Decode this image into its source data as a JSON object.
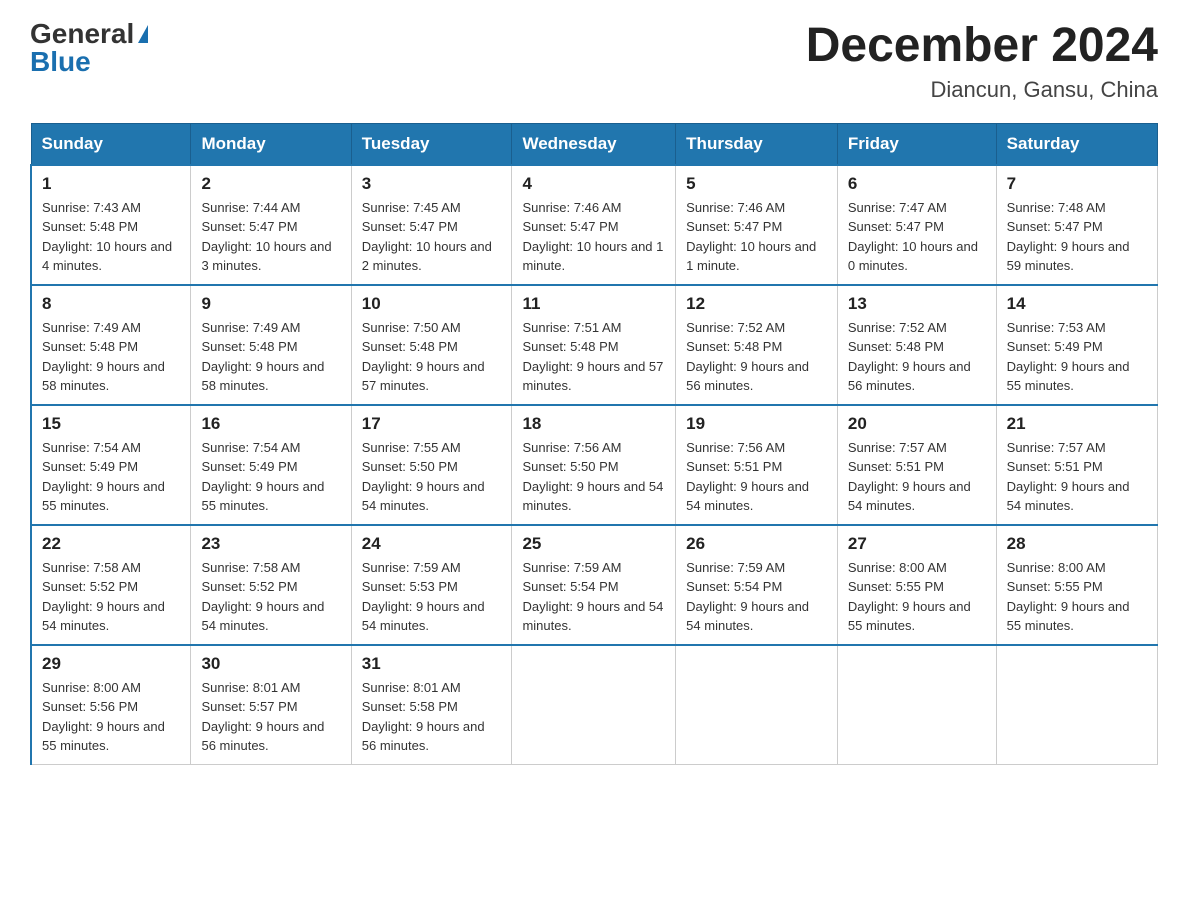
{
  "header": {
    "logo": {
      "general": "General",
      "blue": "Blue"
    },
    "title": "December 2024",
    "location": "Diancun, Gansu, China"
  },
  "days_of_week": [
    "Sunday",
    "Monday",
    "Tuesday",
    "Wednesday",
    "Thursday",
    "Friday",
    "Saturday"
  ],
  "weeks": [
    [
      {
        "day": "1",
        "sunrise": "7:43 AM",
        "sunset": "5:48 PM",
        "daylight": "10 hours and 4 minutes."
      },
      {
        "day": "2",
        "sunrise": "7:44 AM",
        "sunset": "5:47 PM",
        "daylight": "10 hours and 3 minutes."
      },
      {
        "day": "3",
        "sunrise": "7:45 AM",
        "sunset": "5:47 PM",
        "daylight": "10 hours and 2 minutes."
      },
      {
        "day": "4",
        "sunrise": "7:46 AM",
        "sunset": "5:47 PM",
        "daylight": "10 hours and 1 minute."
      },
      {
        "day": "5",
        "sunrise": "7:46 AM",
        "sunset": "5:47 PM",
        "daylight": "10 hours and 1 minute."
      },
      {
        "day": "6",
        "sunrise": "7:47 AM",
        "sunset": "5:47 PM",
        "daylight": "10 hours and 0 minutes."
      },
      {
        "day": "7",
        "sunrise": "7:48 AM",
        "sunset": "5:47 PM",
        "daylight": "9 hours and 59 minutes."
      }
    ],
    [
      {
        "day": "8",
        "sunrise": "7:49 AM",
        "sunset": "5:48 PM",
        "daylight": "9 hours and 58 minutes."
      },
      {
        "day": "9",
        "sunrise": "7:49 AM",
        "sunset": "5:48 PM",
        "daylight": "9 hours and 58 minutes."
      },
      {
        "day": "10",
        "sunrise": "7:50 AM",
        "sunset": "5:48 PM",
        "daylight": "9 hours and 57 minutes."
      },
      {
        "day": "11",
        "sunrise": "7:51 AM",
        "sunset": "5:48 PM",
        "daylight": "9 hours and 57 minutes."
      },
      {
        "day": "12",
        "sunrise": "7:52 AM",
        "sunset": "5:48 PM",
        "daylight": "9 hours and 56 minutes."
      },
      {
        "day": "13",
        "sunrise": "7:52 AM",
        "sunset": "5:48 PM",
        "daylight": "9 hours and 56 minutes."
      },
      {
        "day": "14",
        "sunrise": "7:53 AM",
        "sunset": "5:49 PM",
        "daylight": "9 hours and 55 minutes."
      }
    ],
    [
      {
        "day": "15",
        "sunrise": "7:54 AM",
        "sunset": "5:49 PM",
        "daylight": "9 hours and 55 minutes."
      },
      {
        "day": "16",
        "sunrise": "7:54 AM",
        "sunset": "5:49 PM",
        "daylight": "9 hours and 55 minutes."
      },
      {
        "day": "17",
        "sunrise": "7:55 AM",
        "sunset": "5:50 PM",
        "daylight": "9 hours and 54 minutes."
      },
      {
        "day": "18",
        "sunrise": "7:56 AM",
        "sunset": "5:50 PM",
        "daylight": "9 hours and 54 minutes."
      },
      {
        "day": "19",
        "sunrise": "7:56 AM",
        "sunset": "5:51 PM",
        "daylight": "9 hours and 54 minutes."
      },
      {
        "day": "20",
        "sunrise": "7:57 AM",
        "sunset": "5:51 PM",
        "daylight": "9 hours and 54 minutes."
      },
      {
        "day": "21",
        "sunrise": "7:57 AM",
        "sunset": "5:51 PM",
        "daylight": "9 hours and 54 minutes."
      }
    ],
    [
      {
        "day": "22",
        "sunrise": "7:58 AM",
        "sunset": "5:52 PM",
        "daylight": "9 hours and 54 minutes."
      },
      {
        "day": "23",
        "sunrise": "7:58 AM",
        "sunset": "5:52 PM",
        "daylight": "9 hours and 54 minutes."
      },
      {
        "day": "24",
        "sunrise": "7:59 AM",
        "sunset": "5:53 PM",
        "daylight": "9 hours and 54 minutes."
      },
      {
        "day": "25",
        "sunrise": "7:59 AM",
        "sunset": "5:54 PM",
        "daylight": "9 hours and 54 minutes."
      },
      {
        "day": "26",
        "sunrise": "7:59 AM",
        "sunset": "5:54 PM",
        "daylight": "9 hours and 54 minutes."
      },
      {
        "day": "27",
        "sunrise": "8:00 AM",
        "sunset": "5:55 PM",
        "daylight": "9 hours and 55 minutes."
      },
      {
        "day": "28",
        "sunrise": "8:00 AM",
        "sunset": "5:55 PM",
        "daylight": "9 hours and 55 minutes."
      }
    ],
    [
      {
        "day": "29",
        "sunrise": "8:00 AM",
        "sunset": "5:56 PM",
        "daylight": "9 hours and 55 minutes."
      },
      {
        "day": "30",
        "sunrise": "8:01 AM",
        "sunset": "5:57 PM",
        "daylight": "9 hours and 56 minutes."
      },
      {
        "day": "31",
        "sunrise": "8:01 AM",
        "sunset": "5:58 PM",
        "daylight": "9 hours and 56 minutes."
      },
      null,
      null,
      null,
      null
    ]
  ],
  "labels": {
    "sunrise": "Sunrise:",
    "sunset": "Sunset:",
    "daylight": "Daylight:"
  }
}
